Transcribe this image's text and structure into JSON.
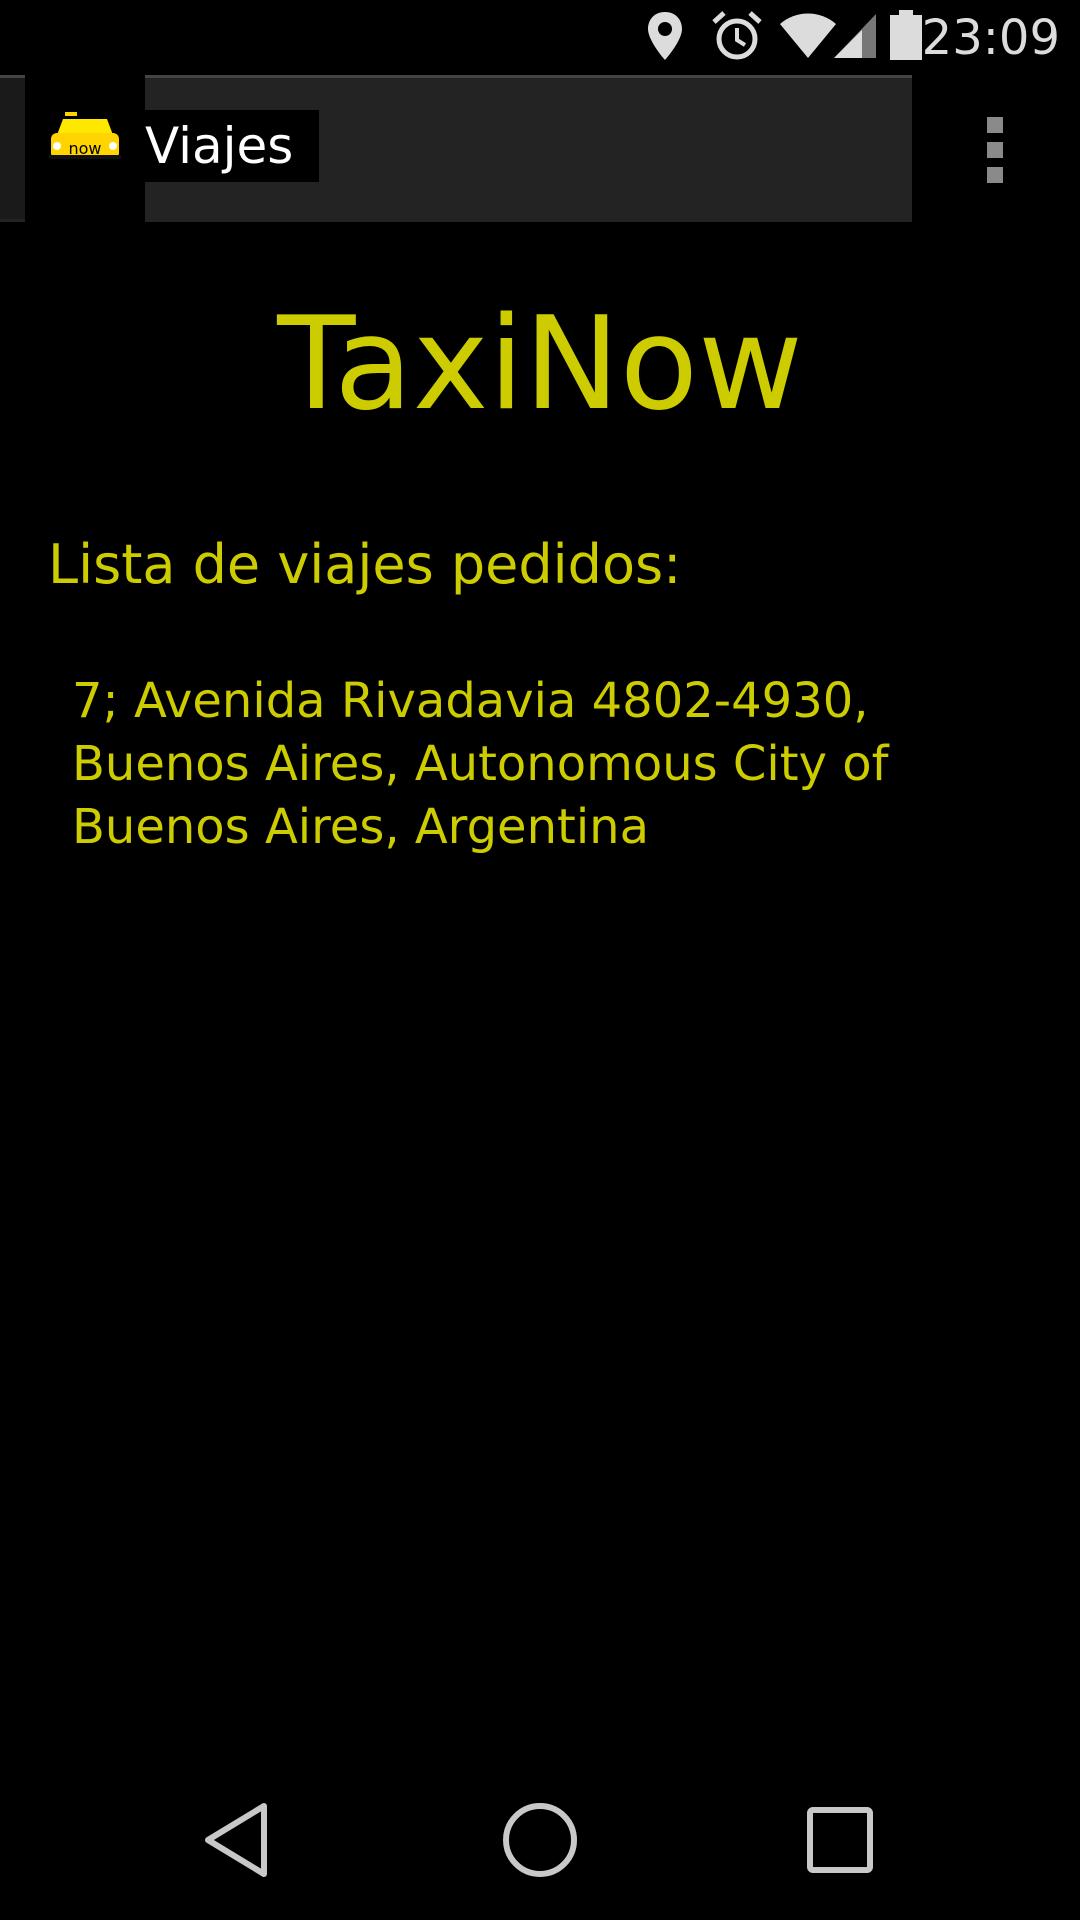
{
  "status_bar": {
    "time": "23:09",
    "icons": [
      "location-icon",
      "alarm-icon",
      "wifi-icon",
      "signal-icon",
      "battery-icon"
    ]
  },
  "action_bar": {
    "title": "Viajes",
    "logo": {
      "icon": "taxi-now-logo",
      "text": "now"
    },
    "overflow_icon": "overflow-menu-icon"
  },
  "content": {
    "brand": "TaxiNow",
    "heading": "Lista de viajes pedidos:",
    "trips": [
      "7; Avenida Rivadavia 4802-4930, Buenos Aires, Autonomous City of Buenos Aires, Argentina"
    ]
  },
  "nav_bar": {
    "back": "back-icon",
    "home": "home-icon",
    "recents": "recents-icon"
  },
  "colors": {
    "accent": "#cccc00",
    "background": "#000000",
    "action_bar": "#232323"
  }
}
